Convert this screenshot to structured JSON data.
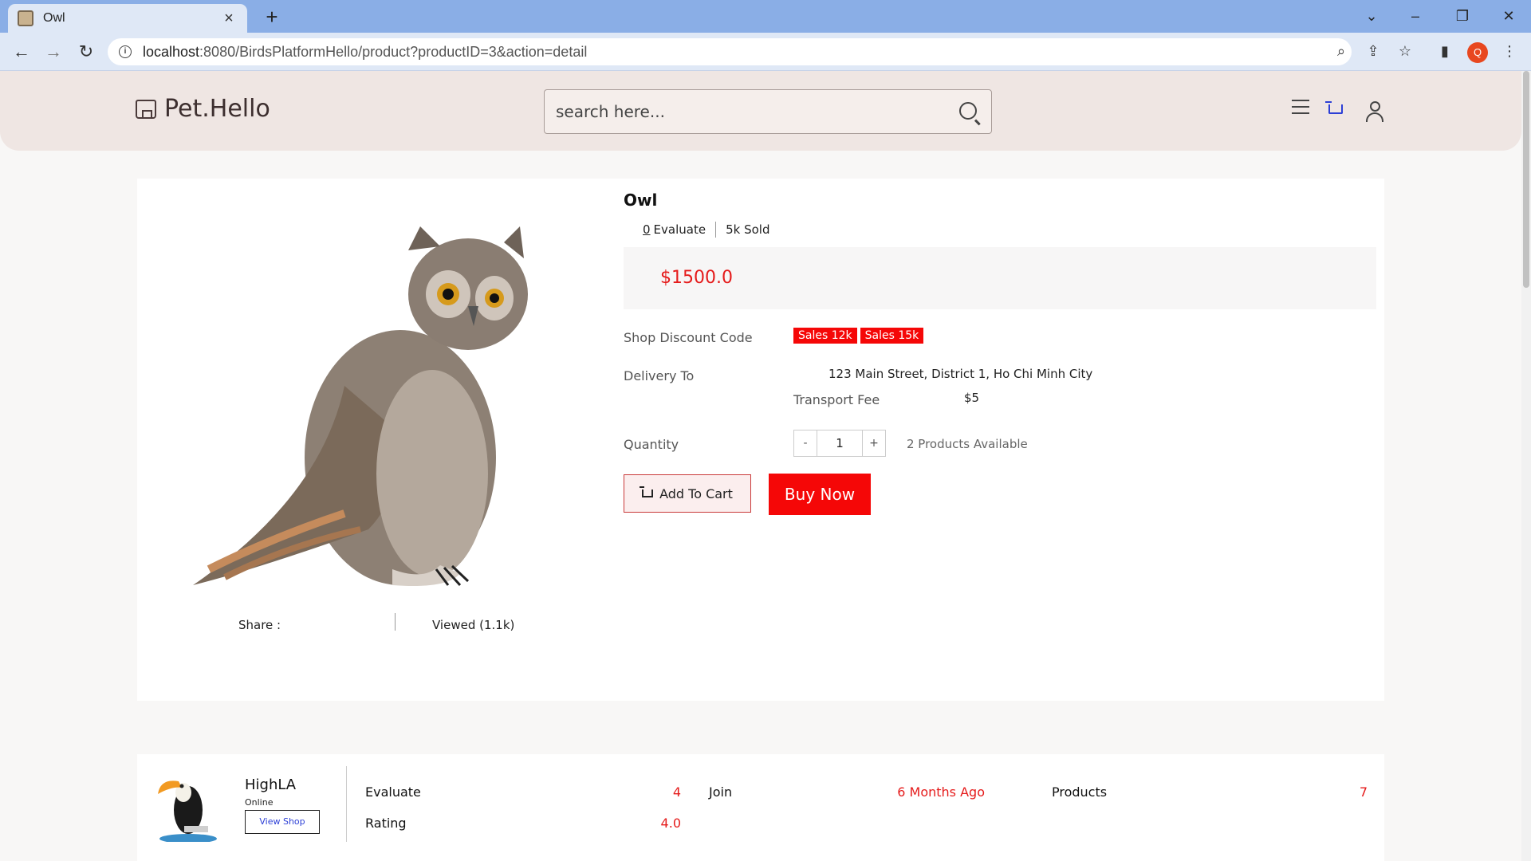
{
  "browser": {
    "tab_title": "Owl",
    "new_tab": "+",
    "tab_close": "×",
    "url_host": "localhost",
    "url_path": ":8080/BirdsPlatformHello/product?productID=3&action=detail",
    "profile_initial": "Q"
  },
  "header": {
    "logo": "Pet.Hello",
    "search_placeholder": "search here..."
  },
  "product": {
    "title": "Owl",
    "evaluate_count": "0",
    "evaluate_label": "Evaluate",
    "sold": "5k Sold",
    "price": "$1500.0",
    "discount_label": "Shop Discount Code",
    "coupons": [
      "Sales 12k",
      "Sales 15k"
    ],
    "delivery_label": "Delivery To",
    "delivery_address": "123 Main Street, District 1, Ho Chi Minh City",
    "transport_label": "Transport Fee",
    "transport_fee": "$5",
    "quantity_label": "Quantity",
    "quantity_minus": "-",
    "quantity_value": "1",
    "quantity_plus": "+",
    "available": "2 Products Available",
    "add_to_cart": "Add To Cart",
    "buy_now": "Buy Now",
    "share": "Share :",
    "viewed": "Viewed (1.1k)"
  },
  "shop": {
    "name": "HighLA",
    "status": "Online",
    "view_shop": "View Shop",
    "evaluate_label": "Evaluate",
    "evaluate_value": "4",
    "rating_label": "Rating",
    "rating_value": "4.0",
    "join_label": "Join",
    "join_value": "6 Months Ago",
    "products_label": "Products",
    "products_value": "7"
  },
  "colors": {
    "accent_red": "#f50707",
    "price_red": "#e51b1b",
    "header_bg": "#efe6e3",
    "chrome_blue": "#8aaee6"
  }
}
